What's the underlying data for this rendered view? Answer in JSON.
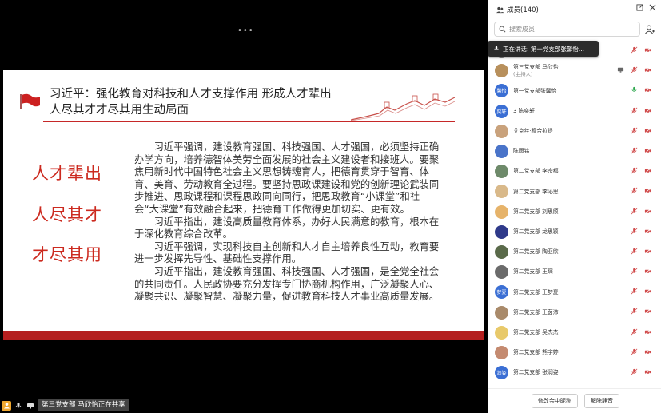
{
  "stage": {
    "more_dots": "•••",
    "slide": {
      "title_line1": "习近平：强化教育对科技和人才支撑作用 形成人才辈出",
      "title_line2": "人尽其才才尽其用生动局面",
      "phrases": [
        "人才辈出",
        "人尽其才",
        "才尽其用"
      ],
      "paragraphs": [
        "习近平强调，建设教育强国、科技强国、人才强国，必须坚持正确办学方向，培养德智体美劳全面发展的社会主义建设者和接班人。要聚焦用新时代中国特色社会主义思想铸魂育人，把德育贯穿于智育、体育、美育、劳动教育全过程。要坚持思政课建设和党的创新理论武装同步推进、思政课程和课程思政同向同行，把思政教育“小课堂”和社会“大课堂”有效融合起来，把德育工作做得更加切实、更有效。",
        "习近平指出，建设高质量教育体系，办好人民满意的教育，根本在于深化教育综合改革。",
        "习近平强调，实现科技自主创新和人才自主培养良性互动，教育要进一步发挥先导性、基础性支撑作用。",
        "习近平指出，建设教育强国、科技强国、人才强国，是全党全社会的共同责任。人民政协要充分发挥专门协商机构作用，广泛凝聚人心、凝聚共识、凝聚智慧、凝聚力量，促进教育科技人才事业高质量发展。"
      ]
    },
    "presenter_text": "第三党支部 马欣怡正在共享"
  },
  "sidebar": {
    "title": "成员(140)",
    "search_placeholder": "搜索成员",
    "speaking_tip": "正在讲话:  第一党支部张馨怡...",
    "footer_buttons": [
      "修改会中昵称",
      "解除静音"
    ],
    "members": [
      {
        "name": "",
        "sub": "",
        "avatar_color": "#8a8a8a",
        "avatar_text": ""
      },
      {
        "name": "第三党支部 马欣怡",
        "sub": "(主持人)",
        "avatar_color": "#b8905c",
        "avatar_text": ""
      },
      {
        "name": "第一党支部张馨怡",
        "sub": "",
        "avatar_color": "#3b6fd4",
        "avatar_text": "馨怡"
      },
      {
        "name": "3 陈奕轩",
        "sub": "",
        "avatar_color": "#3b6fd4",
        "avatar_text": "奕轩"
      },
      {
        "name": "艾克丝·穆合拉提",
        "sub": "",
        "avatar_color": "#c9a27c",
        "avatar_text": ""
      },
      {
        "name": "陈雨铭",
        "sub": "",
        "avatar_color": "#4a74c9",
        "avatar_text": ""
      },
      {
        "name": "第二党支部 李宗都",
        "sub": "",
        "avatar_color": "#6e8a6a",
        "avatar_text": ""
      },
      {
        "name": "第二党支部 李沁思",
        "sub": "",
        "avatar_color": "#d9b98a",
        "avatar_text": ""
      },
      {
        "name": "第二党支部 刘思颀",
        "sub": "",
        "avatar_color": "#e6b36a",
        "avatar_text": ""
      },
      {
        "name": "第二党支部 龙思颖",
        "sub": "",
        "avatar_color": "#2f3a8a",
        "avatar_text": ""
      },
      {
        "name": "第二党支部 陶亚欣",
        "sub": "",
        "avatar_color": "#5a6a4a",
        "avatar_text": ""
      },
      {
        "name": "第二党支部 王琛",
        "sub": "",
        "avatar_color": "#6b6b6b",
        "avatar_text": ""
      },
      {
        "name": "第二党支部 王梦夏",
        "sub": "",
        "avatar_color": "#3b6fd4",
        "avatar_text": "梦夏"
      },
      {
        "name": "第二党支部 王茵沛",
        "sub": "",
        "avatar_color": "#a98a6a",
        "avatar_text": ""
      },
      {
        "name": "第二党支部 吴杰杰",
        "sub": "",
        "avatar_color": "#e8c96a",
        "avatar_text": ""
      },
      {
        "name": "第二党支部 熊宇婷",
        "sub": "",
        "avatar_color": "#c48a70",
        "avatar_text": ""
      },
      {
        "name": "第二党支部 张润姿",
        "sub": "",
        "avatar_color": "#3b6fd4",
        "avatar_text": "润姿"
      }
    ]
  }
}
